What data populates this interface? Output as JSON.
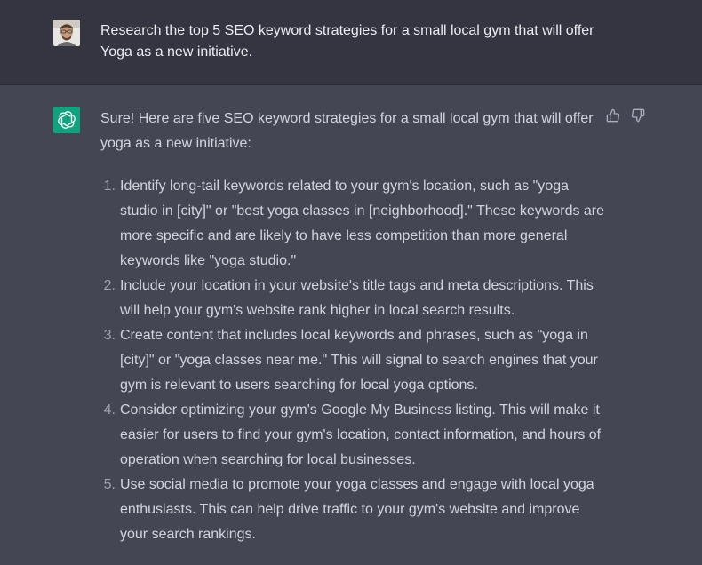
{
  "user_message": {
    "text": "Research the top 5 SEO keyword strategies for a small local gym that will offer Yoga as a new initiative."
  },
  "assistant_message": {
    "intro": "Sure! Here are five SEO keyword strategies for a small local gym that will offer yoga as a new initiative:",
    "items": [
      {
        "number": "1.",
        "text": "Identify long-tail keywords related to your gym's location, such as \"yoga studio in [city]\" or \"best yoga classes in [neighborhood].\" These keywords are more specific and are likely to have less competition than more general keywords like \"yoga studio.\""
      },
      {
        "number": "2.",
        "text": "Include your location in your website's title tags and meta descriptions. This will help your gym's website rank higher in local search results."
      },
      {
        "number": "3.",
        "text": "Create content that includes local keywords and phrases, such as \"yoga in [city]\" or \"yoga classes near me.\" This will signal to search engines that your gym is relevant to users searching for local yoga options."
      },
      {
        "number": "4.",
        "text": "Consider optimizing your gym's Google My Business listing. This will make it easier for users to find your gym's location, contact information, and hours of operation when searching for local businesses."
      },
      {
        "number": "5.",
        "text": "Use social media to promote your yoga classes and engage with local yoga enthusiasts. This can help drive traffic to your gym's website and improve your search rankings."
      }
    ]
  },
  "icons": {
    "user_avatar": "user-avatar",
    "bot_avatar": "openai-logo-icon",
    "thumbs_up": "thumbs-up-icon",
    "thumbs_down": "thumbs-down-icon"
  },
  "colors": {
    "user_bg": "#343541",
    "assistant_bg": "#444654",
    "bot_avatar_bg": "#10a37f",
    "text": "#d1d5db"
  }
}
